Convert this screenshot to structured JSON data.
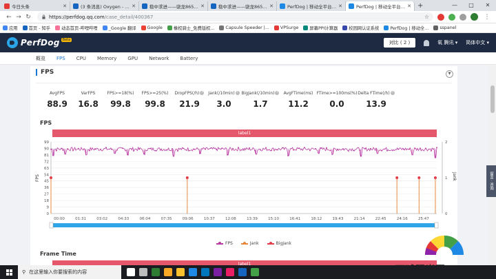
{
  "browser": {
    "tabs": [
      {
        "title": "今日头条",
        "color": "#e53935",
        "active": false
      },
      {
        "title": "(3 条消息) Oxygen - 知乎",
        "color": "#1565c0",
        "active": false
      },
      {
        "title": "稳中求进——骁龙865移动平",
        "color": "#1565c0",
        "active": false
      },
      {
        "title": "稳中求进——骁龙865移动平",
        "color": "#1565c0",
        "active": false
      },
      {
        "title": "PerfDog | 移动全平台性能测",
        "color": "#1e88e5",
        "active": false
      },
      {
        "title": "PerfDog | 移动全平台性能测",
        "color": "#1e88e5",
        "active": true
      }
    ],
    "url_host": "https://perfdog.qq.com",
    "url_path": "/case_detail/400367",
    "new_tab_glyph": "+",
    "window_controls": [
      "—",
      "□",
      "✕"
    ],
    "bookmarks": [
      {
        "label": "应用",
        "color": "#4285f4"
      },
      {
        "label": "首页 - 知乎",
        "color": "#1565c0"
      },
      {
        "label": "动态首页-哔哩哔哩",
        "color": "#fb7299"
      },
      {
        "label": "_Google 翻译",
        "color": "#4285f4"
      },
      {
        "label": "Google",
        "color": "#ea4335"
      },
      {
        "label": "橡权骑士_免费版权...",
        "color": "#43a047"
      },
      {
        "label": "Capsule Speeder |...",
        "color": "#757575"
      },
      {
        "label": "VPSurge",
        "color": "#e53935"
      },
      {
        "label": "屏幕PPI计算器",
        "color": "#00897b"
      },
      {
        "label": "校园网认证系统",
        "color": "#3949ab"
      },
      {
        "label": "PerfDog | 移动全...",
        "color": "#1e88e5"
      },
      {
        "label": "sspanel",
        "color": "#616161"
      }
    ]
  },
  "app": {
    "logo_name": "PerfDog",
    "logo_badge": "Beta",
    "compare_label": "对比 ( 2 )",
    "user_label": "氧 腾讯 ▾",
    "lang_label": "简体中文 ▾",
    "tabs": [
      {
        "label": "概览",
        "active": false
      },
      {
        "label": "FPS",
        "active": true
      },
      {
        "label": "CPU",
        "active": false
      },
      {
        "label": "Memory",
        "active": false
      },
      {
        "label": "GPU",
        "active": false
      },
      {
        "label": "Network",
        "active": false
      },
      {
        "label": "Battery",
        "active": false
      }
    ]
  },
  "fps_section": {
    "title": "FPS",
    "collapse_glyph": "▼",
    "metrics": [
      {
        "label": "AvgFPS",
        "value": "88.9",
        "help": false
      },
      {
        "label": "VarFPS",
        "value": "16.8",
        "help": false
      },
      {
        "label": "FPS>=18(%)",
        "value": "99.8",
        "help": false
      },
      {
        "label": "FPS>=25(%)",
        "value": "99.8",
        "help": false
      },
      {
        "label": "DropFPS(/h)",
        "value": "21.9",
        "help": true
      },
      {
        "label": "Jank(/10min)",
        "value": "3.0",
        "help": true
      },
      {
        "label": "BigJank(/10min)",
        "value": "1.7",
        "help": true
      },
      {
        "label": "AvgFTime(ms)",
        "value": "11.2",
        "help": false
      },
      {
        "label": "FTime>=100ms(%)",
        "value": "0.0",
        "help": false
      },
      {
        "label": "Delta FTime(/h)",
        "value": "13.9",
        "help": true
      }
    ],
    "help_glyph": "?",
    "chart_title": "FPS",
    "label_bar": "label1",
    "frame_time_title": "Frame Time",
    "frame_time_label_bar": "label1"
  },
  "chart_data": {
    "type": "line",
    "ylabel": "FPS",
    "y2label": "Jank",
    "ylim": [
      0,
      99
    ],
    "yticks": [
      0,
      9,
      18,
      27,
      36,
      45,
      54,
      63,
      72,
      81,
      90,
      99
    ],
    "y2lim": [
      0,
      2
    ],
    "y2ticks": [
      0,
      1,
      2
    ],
    "xticks": [
      "00:00",
      "01:31",
      "03:02",
      "04:33",
      "06:04",
      "07:35",
      "09:06",
      "10:37",
      "12:08",
      "13:39",
      "15:10",
      "16:41",
      "18:12",
      "19:43",
      "21:14",
      "22:45",
      "24:16",
      "25:47"
    ],
    "duration_seconds": 1656,
    "grid": true,
    "legend_position": "bottom",
    "series": [
      {
        "name": "FPS",
        "color": "#b93aa3",
        "baseline": 89,
        "noise": 2.5,
        "dips": [
          [
            10,
            80
          ],
          [
            60,
            82
          ],
          [
            150,
            81
          ],
          [
            275,
            83
          ],
          [
            330,
            81
          ],
          [
            400,
            82
          ],
          [
            525,
            79
          ],
          [
            640,
            83
          ],
          [
            760,
            81
          ],
          [
            880,
            82
          ],
          [
            1020,
            80
          ],
          [
            1150,
            83
          ],
          [
            1210,
            82
          ],
          [
            1330,
            79
          ],
          [
            1400,
            83
          ],
          [
            1550,
            81
          ],
          [
            1650,
            77
          ]
        ]
      },
      {
        "name": "Jank",
        "color": "#e8873a",
        "events_seconds": [
          0,
          585,
          1485,
          1580,
          1650
        ],
        "event_value": 1
      },
      {
        "name": "BigJank",
        "color": "#e33c4a",
        "events_seconds": [
          0,
          585,
          1485,
          1580,
          1650
        ],
        "event_value": 1
      }
    ]
  },
  "page_side": {
    "widget_label": "留言 · 咨询"
  },
  "taskbar": {
    "search_placeholder": "在这里输入你要搜索的内容",
    "icons": [
      "#ffffff",
      "#bdbdbd",
      "#2e7d32",
      "#f9a825",
      "#fbc02d",
      "#1e88e5",
      "#0277bd",
      "#7b1fa2",
      "#e91e63",
      "#1565c0",
      "#43a047"
    ]
  },
  "watermark": {
    "text": "环球阳光网"
  }
}
